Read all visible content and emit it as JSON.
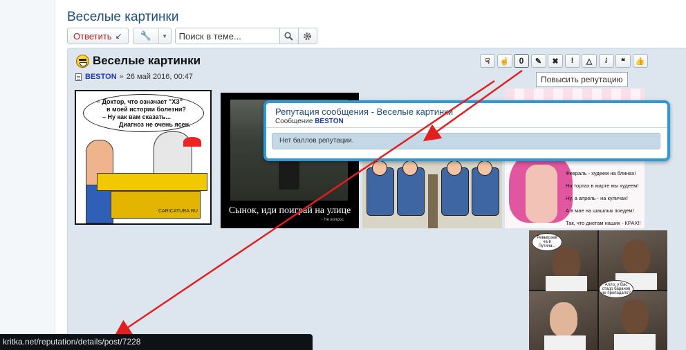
{
  "thread": {
    "title": "Веселые картинки"
  },
  "toolbar": {
    "reply_label": "Ответить",
    "search_placeholder": "Поиск в теме..."
  },
  "post": {
    "title": "Веселые картинки",
    "author": "BESTON",
    "separator": "»",
    "date": "26 май 2016, 00:47",
    "reputation_count": "0",
    "actions": [
      {
        "icon": "thumb-down-icon"
      },
      {
        "icon": "thumb-up-hand-icon"
      },
      {
        "icon": "reputation-count"
      },
      {
        "icon": "pencil-icon"
      },
      {
        "icon": "close-icon"
      },
      {
        "icon": "exclamation-icon"
      },
      {
        "icon": "warning-icon"
      },
      {
        "icon": "info-icon"
      },
      {
        "icon": "quote-icon"
      },
      {
        "icon": "like-icon"
      }
    ]
  },
  "tooltip": {
    "text": "Повысить репутацию"
  },
  "images": {
    "img1_lines": [
      "– Доктор, что означает \"ХЗ\"",
      "в моей истории болезни?",
      "– Ну как вам сказать...",
      "Диагноз не очень ясен."
    ],
    "img1_signature": "CARICATURA.RU",
    "img2_caption": "Сынок, иди поиграй на улице",
    "img2_sub": "- Не вопрос",
    "img4_lines": [
      "Февраль - худеем на блинах!",
      "На тортах в марте мы худеем!",
      "Ну, а апрель - на куличах!",
      "А в мае на шашлык поедем!",
      "Так, что диетам наших - КРАХ!!"
    ],
    "img5_bubble1": "Ревыгрзев ча в Путина...",
    "img5_bubble2": "Алло, у Вас стадо баранов не пропадало?"
  },
  "reputation_popup": {
    "title": "Репутация сообщения - Веселые картинки",
    "subtitle_prefix": "Сообщение",
    "author": "BESTON",
    "body": "Нет баллов репутации."
  },
  "status_bar": {
    "url": "kritka.net/reputation/details/post/7228"
  },
  "colors": {
    "accent": "#2d9ad8",
    "arrow": "#e02020",
    "title": "#1d4e79",
    "author": "#1838b8"
  }
}
